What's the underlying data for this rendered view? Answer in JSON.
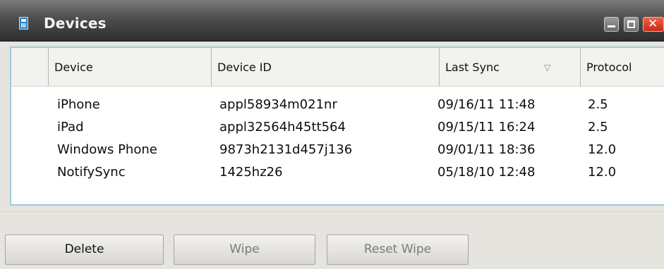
{
  "window": {
    "title": "Devices",
    "icons": {
      "app": "device-calculator-icon",
      "minimize": "minimize-icon",
      "maximize": "maximize-icon",
      "close": "close-icon",
      "sort": "sort-descending-icon"
    },
    "close_glyph": "✕"
  },
  "table": {
    "columns": [
      {
        "key": "device",
        "label": "Device"
      },
      {
        "key": "device_id",
        "label": "Device ID"
      },
      {
        "key": "last_sync",
        "label": "Last Sync",
        "sorted": "descending"
      },
      {
        "key": "protocol",
        "label": "Protocol"
      }
    ],
    "sort_glyph": "▽",
    "rows": [
      {
        "device": "iPhone",
        "device_id": "appl58934m021nr",
        "last_sync": "09/16/11 11:48",
        "protocol": "2.5"
      },
      {
        "device": "iPad",
        "device_id": "appl32564h45tt564",
        "last_sync": "09/15/11 16:24",
        "protocol": "2.5"
      },
      {
        "device": "Windows Phone",
        "device_id": "9873h2131d457j136",
        "last_sync": "09/01/11 18:36",
        "protocol": "12.0"
      },
      {
        "device": "NotifySync",
        "device_id": "1425hz26",
        "last_sync": "05/18/10 12:48",
        "protocol": "12.0"
      }
    ]
  },
  "buttons": {
    "delete": "Delete",
    "wipe": "Wipe",
    "reset_wipe": "Reset Wipe"
  },
  "colors": {
    "titlebar": "#4e4e4e",
    "panel_border": "#9ecbdc",
    "close_button": "#e04a33",
    "disabled_text": "#7a7a7a"
  }
}
